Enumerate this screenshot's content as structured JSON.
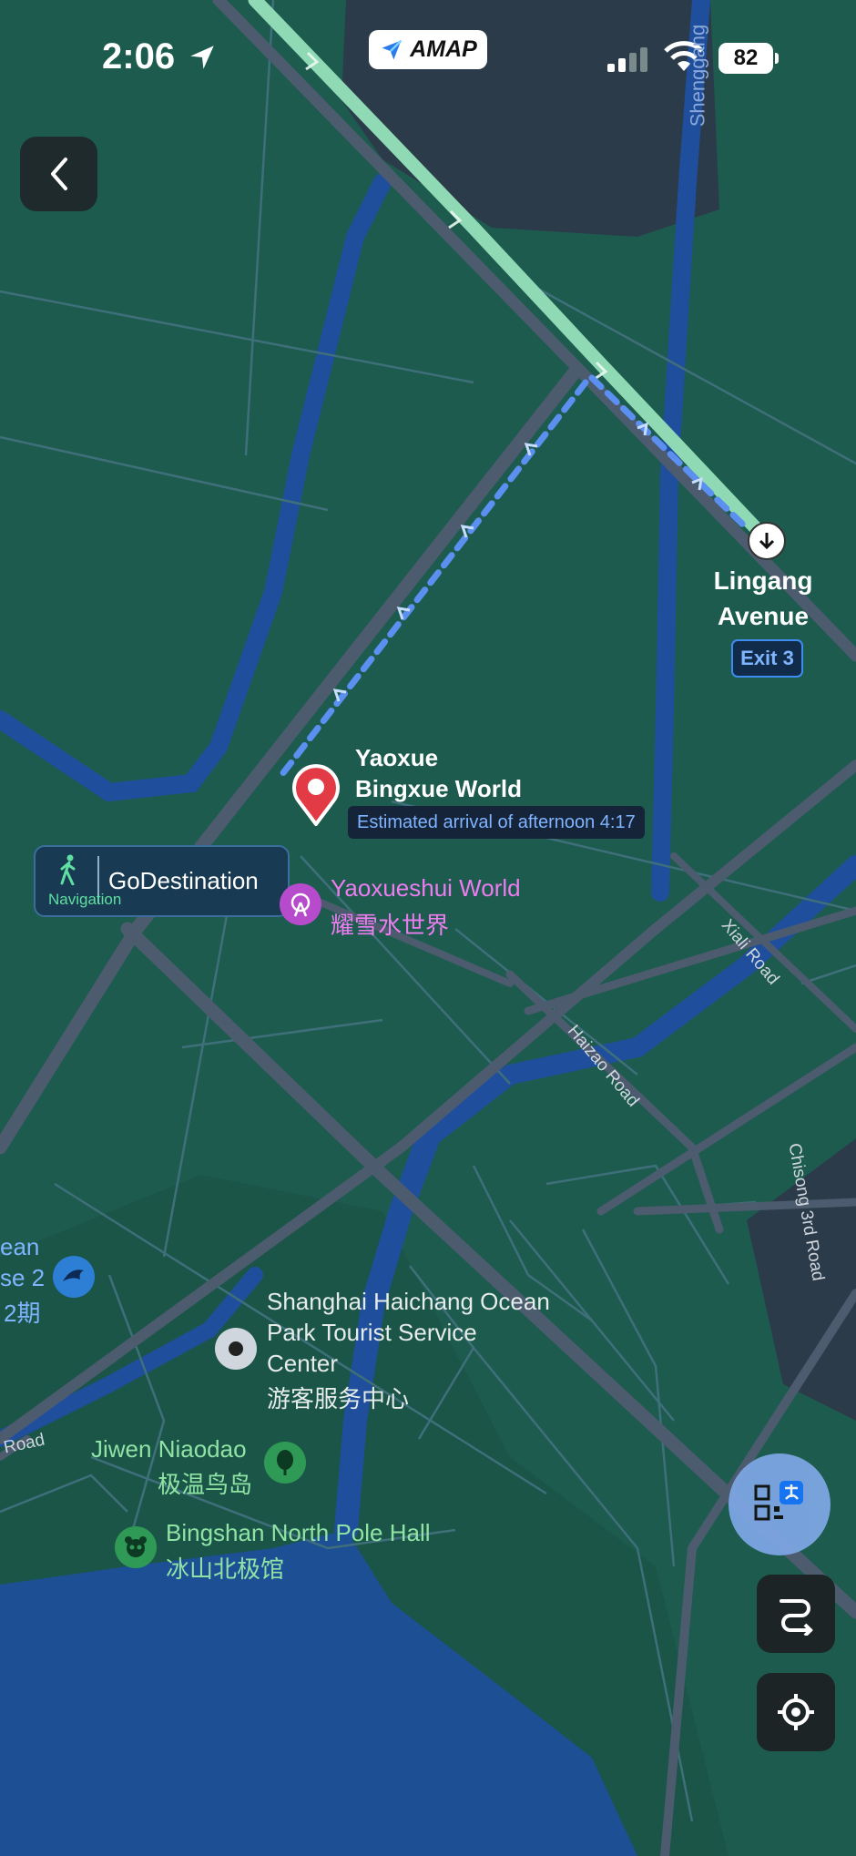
{
  "status_bar": {
    "time": "2:06",
    "app_label": "AMAP",
    "battery": "82",
    "icons": [
      "location-arrow-icon",
      "signal-icon",
      "wifi-icon",
      "battery-icon"
    ]
  },
  "destination": {
    "name_line1": "Yaoxue",
    "name_line2": "Bingxue World",
    "eta": "Estimated arrival of afternoon 4:17"
  },
  "exit": {
    "name_line1": "Lingang",
    "name_line2": "Avenue",
    "badge": "Exit 3"
  },
  "navigation_bubble": {
    "label": "GoDestination",
    "sub_label": "Navigation"
  },
  "pois": [
    {
      "name_en": "Yaoxueshui World",
      "name_zh": "耀雪水世界",
      "icon": "ferris-wheel-icon",
      "color": "#d25fe3"
    },
    {
      "name_en": "Shanghai Haichang Ocean",
      "name_en_2": "Park Tourist Service",
      "name_en_3": "Center",
      "name_zh": "游客服务中心",
      "icon": "service-center-icon",
      "color": "#cfd6de"
    },
    {
      "name_en": "Jiwen Niaodao",
      "name_zh": "极温鸟岛",
      "icon": "tree-icon",
      "color": "#2f9a55"
    },
    {
      "name_en": "Bingshan North Pole Hall",
      "name_zh": "冰山北极馆",
      "icon": "panda-icon",
      "color": "#2f9a55"
    },
    {
      "name_en": "ean",
      "name_en_2": "se 2",
      "name_zh": "2期",
      "icon": "dolphin-icon",
      "color": "#2d7fd6"
    }
  ],
  "roads": {
    "shenggang": "Shenggang",
    "xiali": "Xiali Road",
    "haizao": "Haizao Road",
    "chisong": "Chisong 3rd Road",
    "road_left": "Road"
  },
  "colors": {
    "land": "#1d5b4e",
    "water": "#1f4f9c",
    "route_walk": "#4f8ff5",
    "highway": "#8fd9b4",
    "destination_pin": "#e23b45"
  }
}
